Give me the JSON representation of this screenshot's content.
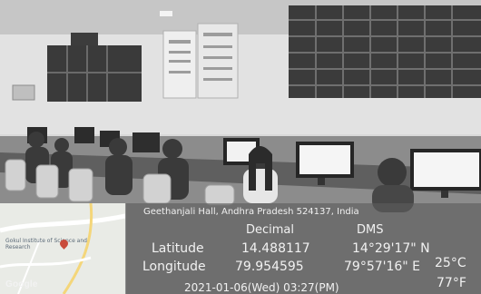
{
  "overlay": {
    "address": "Geethanjali Hall, Andhra Pradesh 524137, India",
    "col_decimal": "Decimal",
    "col_dms": "DMS",
    "latitude_label": "Latitude",
    "latitude_decimal": "14.488117",
    "latitude_dms": "14°29'17\" N",
    "longitude_label": "Longitude",
    "longitude_decimal": "79.954595",
    "longitude_dms": "79°57'16\" E",
    "temp_c": "25°C",
    "temp_f": "77°F",
    "datetime": "2021-01-06(Wed) 03:27(PM)"
  },
  "map": {
    "place_label": "Gokul Institute of Science and Research",
    "logo": "Google"
  },
  "colors": {
    "overlay_bg": "#5c5c5c",
    "overlay_text": "#f1f1f1",
    "map_bg": "#e9ebe6",
    "wall": "#dcdcdc",
    "floor": "#8a8a8a"
  }
}
